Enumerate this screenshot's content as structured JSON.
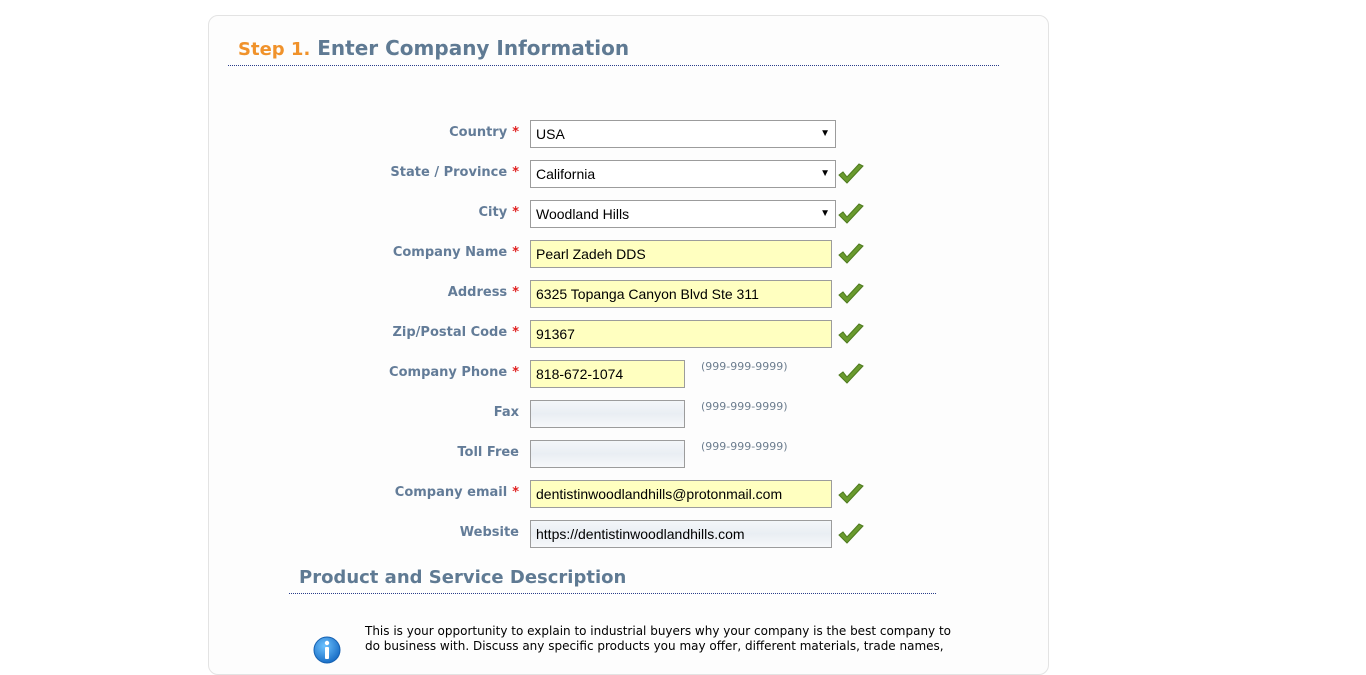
{
  "header": {
    "step": "Step 1.",
    "title": "Enter Company Information"
  },
  "form": {
    "country": {
      "label": "Country",
      "value": "USA"
    },
    "state": {
      "label": "State / Province",
      "value": "California"
    },
    "city": {
      "label": "City",
      "value": "Woodland Hills"
    },
    "company_name": {
      "label": "Company Name",
      "value": "Pearl Zadeh DDS"
    },
    "address": {
      "label": "Address",
      "value": "6325 Topanga Canyon Blvd Ste 311"
    },
    "zip": {
      "label": "Zip/Postal Code",
      "value": "91367"
    },
    "phone": {
      "label": "Company Phone",
      "value": "818-672-1074",
      "hint": "(999-999-9999)"
    },
    "fax": {
      "label": "Fax",
      "value": "",
      "hint": "(999-999-9999)"
    },
    "toll_free": {
      "label": "Toll Free",
      "value": "",
      "hint": "(999-999-9999)"
    },
    "email": {
      "label": "Company email",
      "value": "dentistinwoodlandhills@protonmail.com"
    },
    "website": {
      "label": "Website",
      "value": "https://dentistinwoodlandhills.com"
    },
    "required_mark": "*"
  },
  "section": {
    "title": "Product and Service Description",
    "description": "This is your opportunity to explain to industrial buyers why your company is the best company to do business with. Discuss any specific products you may offer, different materials, trade names,"
  },
  "icons": {
    "valid": "checkmark-icon",
    "info": "info-icon"
  },
  "colors": {
    "accent_orange": "#f0922b",
    "title_blue": "#5f7a93",
    "required_red": "#e02020",
    "field_yellow": "#ffffc0",
    "check_green": "#6a9a2e"
  }
}
